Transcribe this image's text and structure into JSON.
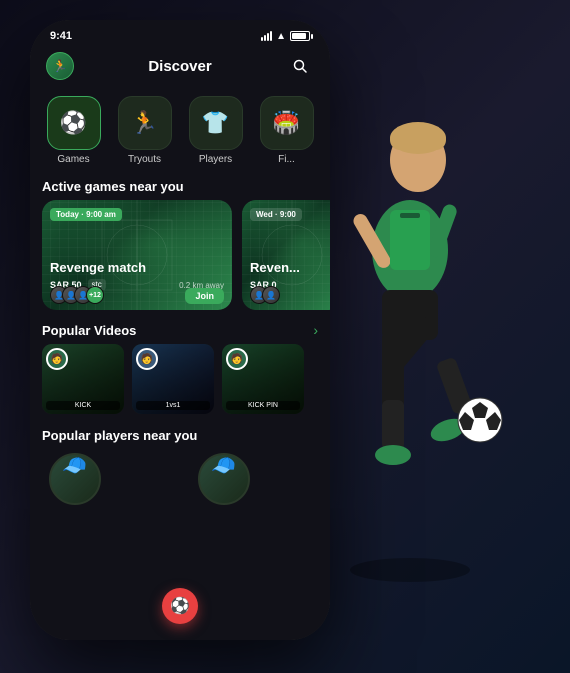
{
  "app": {
    "title": "Discover",
    "time": "9:41"
  },
  "header": {
    "title": "Discover",
    "search_icon": "🔍"
  },
  "categories": [
    {
      "id": "games",
      "label": "Games",
      "icon": "⚽",
      "active": true
    },
    {
      "id": "tryouts",
      "label": "Tryouts",
      "icon": "🏃",
      "active": false
    },
    {
      "id": "players",
      "label": "Players",
      "icon": "👕",
      "active": false
    },
    {
      "id": "field",
      "label": "Fi...",
      "icon": "🏟️",
      "active": false
    }
  ],
  "active_games": {
    "section_title": "Active games near you",
    "cards": [
      {
        "date": "Today · 9:00 am",
        "title": "Revenge match",
        "price": "SAR 50",
        "sponsor": "stc",
        "distance": "0.2 km away",
        "player_count": "+12",
        "join_label": "Join"
      },
      {
        "date": "Wed · 9:00",
        "title": "Reven...",
        "price": "SAR 0",
        "sponsor": "",
        "distance": "",
        "player_count": "",
        "join_label": ""
      }
    ]
  },
  "popular_videos": {
    "section_title": "Popular Videos",
    "see_more_icon": "›",
    "videos": [
      {
        "label": "KICK"
      },
      {
        "label": "1vs1"
      },
      {
        "label": "KICK PIN"
      }
    ]
  },
  "popular_players": {
    "section_title": "Popular players near you",
    "players": [
      {
        "icon": "🧢"
      },
      {
        "icon": "🧢"
      }
    ]
  },
  "fab": {
    "icon": "⚽"
  },
  "colors": {
    "accent": "#3aaa5c",
    "bg_dark": "#111118",
    "card_green": "#1a5c35",
    "fab_red": "#e84040"
  }
}
